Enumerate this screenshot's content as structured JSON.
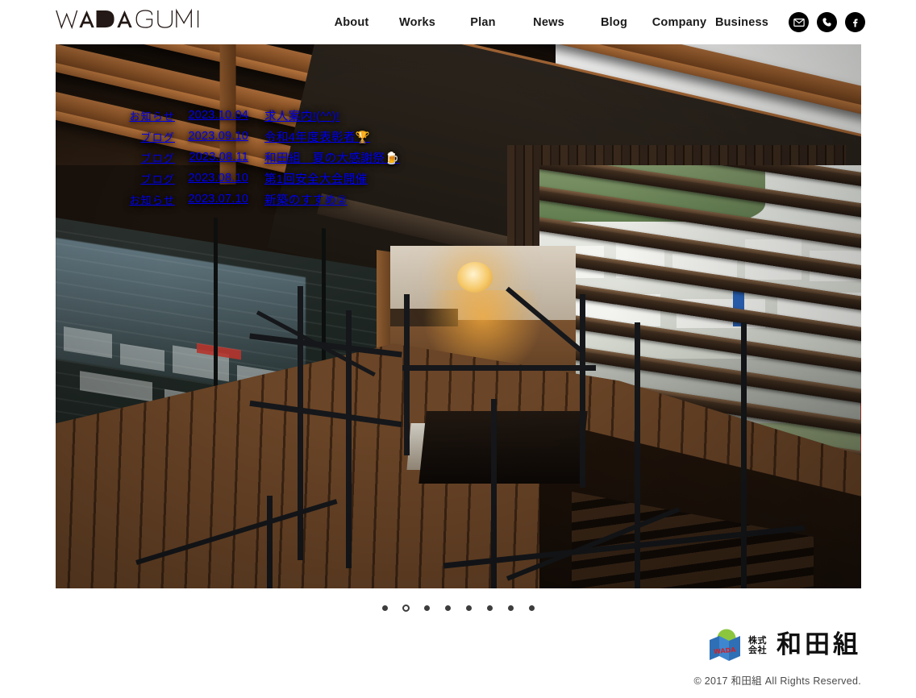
{
  "site": {
    "logo_text": "WADAGUMI",
    "background_color": "#ffffff"
  },
  "header": {
    "nav_items": [
      {
        "label": "About"
      },
      {
        "label": "Works"
      },
      {
        "label": "Plan"
      },
      {
        "label": "News"
      },
      {
        "label": "Blog"
      },
      {
        "label": "Company"
      },
      {
        "label": "Business"
      }
    ],
    "social": [
      {
        "name": "mail-icon",
        "label": "Mail"
      },
      {
        "name": "phone-icon",
        "label": "Phone"
      },
      {
        "name": "facebook-icon",
        "label": "Facebook"
      }
    ]
  },
  "hero": {
    "news": [
      {
        "category": "お知らせ",
        "date": "2023.10.04",
        "title": "求人案内!(^^)!"
      },
      {
        "category": "ブログ",
        "date": "2023.09.10",
        "title": "令和4年度表彰者🏆"
      },
      {
        "category": "ブログ",
        "date": "2023.08.11",
        "title": "和田組　夏の大感謝祭🍺"
      },
      {
        "category": "ブログ",
        "date": "2023.08.10",
        "title": "第1回安全大会開催"
      },
      {
        "category": "お知らせ",
        "date": "2023.07.10",
        "title": "新築のすすめ②"
      }
    ]
  },
  "carousel": {
    "total_slides": 8,
    "active_index": 1,
    "dot_color": "#3d3d3d"
  },
  "footer": {
    "logo": {
      "mark_text": "WADA",
      "mark_green": "#8cc63f",
      "mark_blue": "#2f6fb5",
      "mark_red": "#cc2229",
      "prefix_line1": "株式",
      "prefix_line2": "会社",
      "company_name": "和田組"
    },
    "copyright": "©  2017 和田組 All Rights Reserved."
  }
}
